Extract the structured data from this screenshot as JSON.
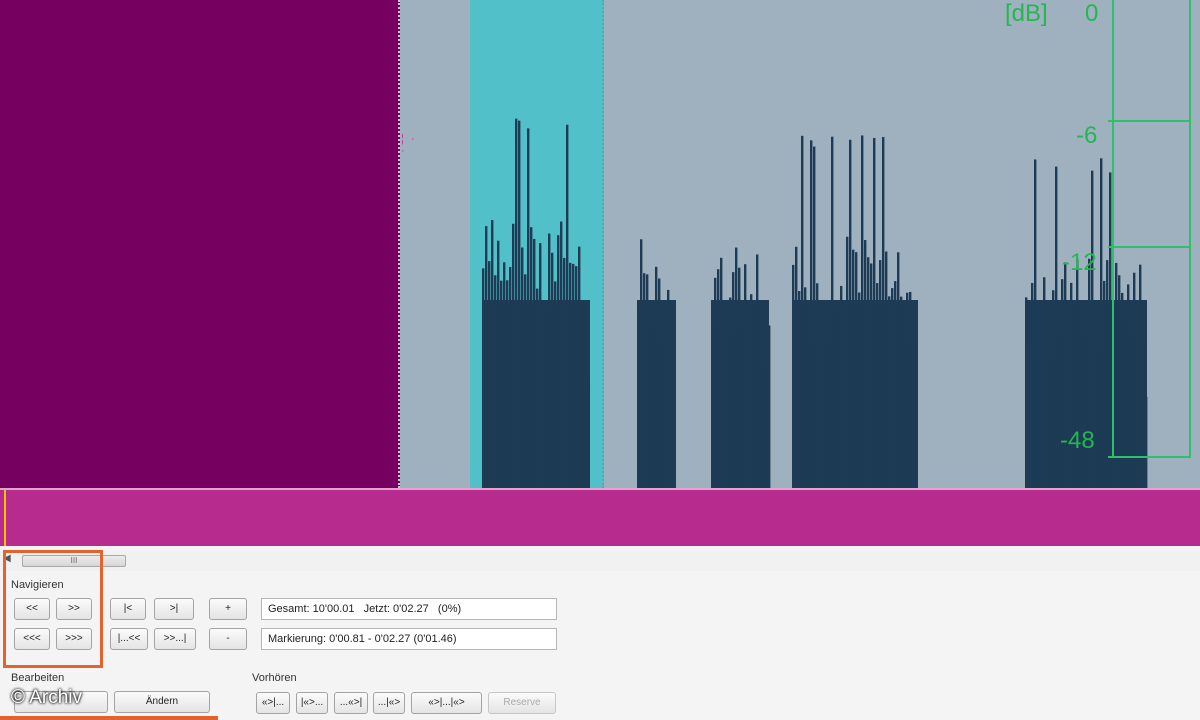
{
  "meter": {
    "unit": "[dB]",
    "labels": [
      "0",
      "-6",
      "-12",
      "-48"
    ]
  },
  "cursor_mark": "¦ · ·",
  "scrollbar": {
    "thumb_grip": "III"
  },
  "navigation": {
    "group_label": "Navigieren",
    "buttons": {
      "back": "<<",
      "forward": ">>",
      "fast_back": "<<<",
      "fast_forward": ">>>",
      "to_start": "|<",
      "to_end": ">|",
      "mark_back": "|...<<",
      "mark_forward": ">>...|",
      "plus": "+",
      "minus": "-"
    },
    "total_field": "Gesamt: 10'00.01   Jetzt: 0'02.27   (0%)",
    "marking_field": "Markierung: 0'00.81 - 0'02.27 (0'01.46)"
  },
  "edit": {
    "group_label": "Bearbeiten",
    "change_button": "Ändern"
  },
  "preview": {
    "group_label": "Vorhören",
    "buttons": [
      "«>|...",
      "|«>...",
      "...«>|",
      "...|«>",
      "«>|...|«>"
    ],
    "reserve": "Reserve"
  },
  "watermark": "© Archiv",
  "colors": {
    "waveform": "#1d3b55",
    "meter": "#23b74f",
    "highlight": "#e4622b"
  }
}
